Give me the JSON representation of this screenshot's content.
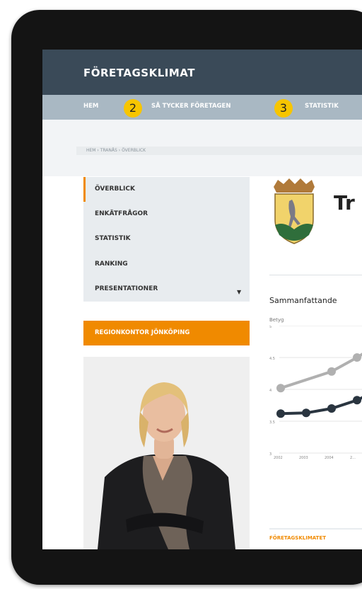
{
  "header": {
    "site_title": "FÖRETAGSKLIMAT"
  },
  "nav": {
    "items": [
      {
        "label": "HEM"
      },
      {
        "label": "SÅ TYCKER FÖRETAGEN",
        "badge": "2"
      },
      {
        "label": "STATISTIK",
        "badge": "3"
      }
    ]
  },
  "breadcrumb": [
    "HEM",
    "TRANÅS",
    "ÖVERBLICK"
  ],
  "sidebar": {
    "items": [
      {
        "label": "ÖVERBLICK",
        "active": true
      },
      {
        "label": "ENKÄTFRÅGOR"
      },
      {
        "label": "STATISTIK"
      },
      {
        "label": "RANKING"
      },
      {
        "label": "PRESENTATIONER",
        "has_dropdown": true
      }
    ],
    "region_button": "REGIONKONTOR JÖNKÖPING"
  },
  "main": {
    "title": "Tr",
    "chart_title": "Sammanfattande",
    "footer_label": "FÖRETAGSKLIMATET"
  },
  "colors": {
    "accent": "#f08a00",
    "header": "#3a4a58",
    "nav": "#a9b8c3",
    "badge": "#f7c500"
  },
  "chart_data": {
    "type": "line",
    "ylabel": "Betyg",
    "yticks": [
      "5",
      "4.5",
      "4",
      "3.5",
      "3"
    ],
    "ylim": [
      3,
      5
    ],
    "x": [
      "2002",
      "2003",
      "2004",
      "2..."
    ],
    "series": [
      {
        "color": "#b0b0b0",
        "values": [
          4.02,
          null,
          4.28,
          4.5
        ]
      },
      {
        "color": "#2a3540",
        "values": [
          3.62,
          3.63,
          3.7,
          3.83
        ]
      }
    ]
  }
}
